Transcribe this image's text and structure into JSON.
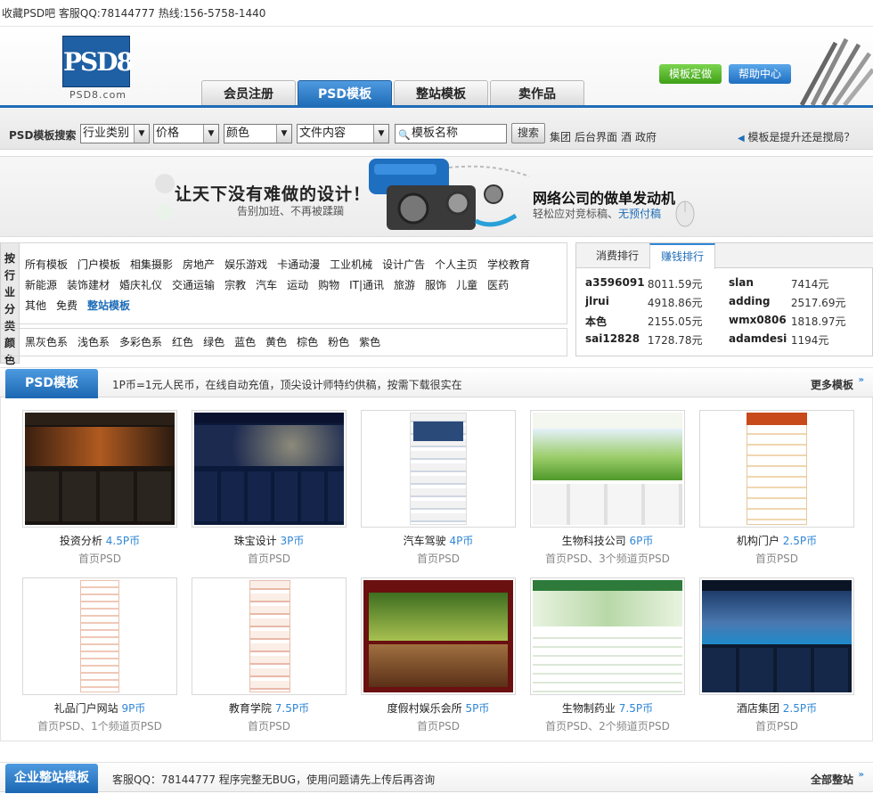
{
  "topbar": {
    "text": "收藏PSD吧 客服QQ:78144777 热线:156-5758-1440"
  },
  "logo": {
    "mark": "PSD8",
    "sub": "PSD8.com"
  },
  "nav": {
    "tabs": [
      "会员注册",
      "PSD模板",
      "整站模板",
      "卖作品"
    ],
    "active": 1
  },
  "header_buttons": {
    "custom": "模板定做",
    "help": "帮助中心"
  },
  "search": {
    "label": "PSD模板搜索",
    "selects": [
      "行业类别",
      "价格",
      "颜色",
      "文件内容"
    ],
    "input_value": "模板名称",
    "button": "搜索",
    "tags": [
      "集团",
      "后台界面",
      "酒",
      "政府"
    ],
    "notice": "模板是提升还是搅局？"
  },
  "banner": {
    "headline": "让天下没有难做的设计！",
    "subline": "告别加班、不再被蹂躏",
    "right_title": "网络公司的做单发动机",
    "right_sub_pre": "轻松应对竞标稿、",
    "right_sub_hl": "无预付稿"
  },
  "categories": {
    "side_label": "按行业分类颜色",
    "row1": [
      "所有模板",
      "门户模板",
      "相集摄影",
      "房地产",
      "娱乐游戏",
      "卡通动漫",
      "工业机械",
      "设计广告",
      "个人主页",
      "学校教育"
    ],
    "row2": [
      "新能源",
      "装饰建材",
      "婚庆礼仪",
      "交通运输",
      "宗教",
      "汽车",
      "运动",
      "购物",
      "IT|通讯",
      "旅游",
      "服饰",
      "儿童",
      "医药"
    ],
    "row3": [
      "其他",
      "免费",
      "整站模板"
    ],
    "colors": [
      "黑灰色系",
      "浅色系",
      "多彩色系",
      "红色",
      "绿色",
      "蓝色",
      "黄色",
      "棕色",
      "粉色",
      "紫色"
    ]
  },
  "ranking": {
    "tabs": [
      "消费排行",
      "赚钱排行"
    ],
    "active": 1,
    "left": [
      {
        "user": "a3596091",
        "amount": "8011.59元"
      },
      {
        "user": "jlrui",
        "amount": "4918.86元"
      },
      {
        "user": "本色",
        "amount": "2155.05元"
      },
      {
        "user": "sai12828",
        "amount": "1728.78元"
      }
    ],
    "right": [
      {
        "user": "slan",
        "amount": "7414元"
      },
      {
        "user": "adding",
        "amount": "2517.69元"
      },
      {
        "user": "wmx0806",
        "amount": "1818.97元"
      },
      {
        "user": "adamdesign",
        "amount": "1194元"
      }
    ]
  },
  "psd_section": {
    "title": "PSD模板",
    "desc": "1P币=1元人民币，在线自动充值，顶尖设计师特约供稿，按需下载很实在",
    "more": "更多模板"
  },
  "products": [
    {
      "name": "投资分析",
      "price": "4.5P币",
      "note": "首页PSD"
    },
    {
      "name": "珠宝设计",
      "price": "3P币",
      "note": "首页PSD"
    },
    {
      "name": "汽车驾驶",
      "price": "4P币",
      "note": "首页PSD"
    },
    {
      "name": "生物科技公司",
      "price": "6P币",
      "note": "首页PSD、3个频道页PSD"
    },
    {
      "name": "机构门户",
      "price": "2.5P币",
      "note": "首页PSD"
    },
    {
      "name": "礼品门户网站",
      "price": "9P币",
      "note": "首页PSD、1个频道页PSD"
    },
    {
      "name": "教育学院",
      "price": "7.5P币",
      "note": "首页PSD"
    },
    {
      "name": "度假村娱乐会所",
      "price": "5P币",
      "note": "首页PSD"
    },
    {
      "name": "生物制药业",
      "price": "7.5P币",
      "note": "首页PSD、2个频道页PSD"
    },
    {
      "name": "酒店集团",
      "price": "2.5P币",
      "note": "首页PSD"
    }
  ],
  "site_section": {
    "title": "企业整站模板",
    "desc": "客服QQ：78144777   程序完整无BUG，使用问题请先上传后再咨询",
    "more": "全部整站"
  }
}
